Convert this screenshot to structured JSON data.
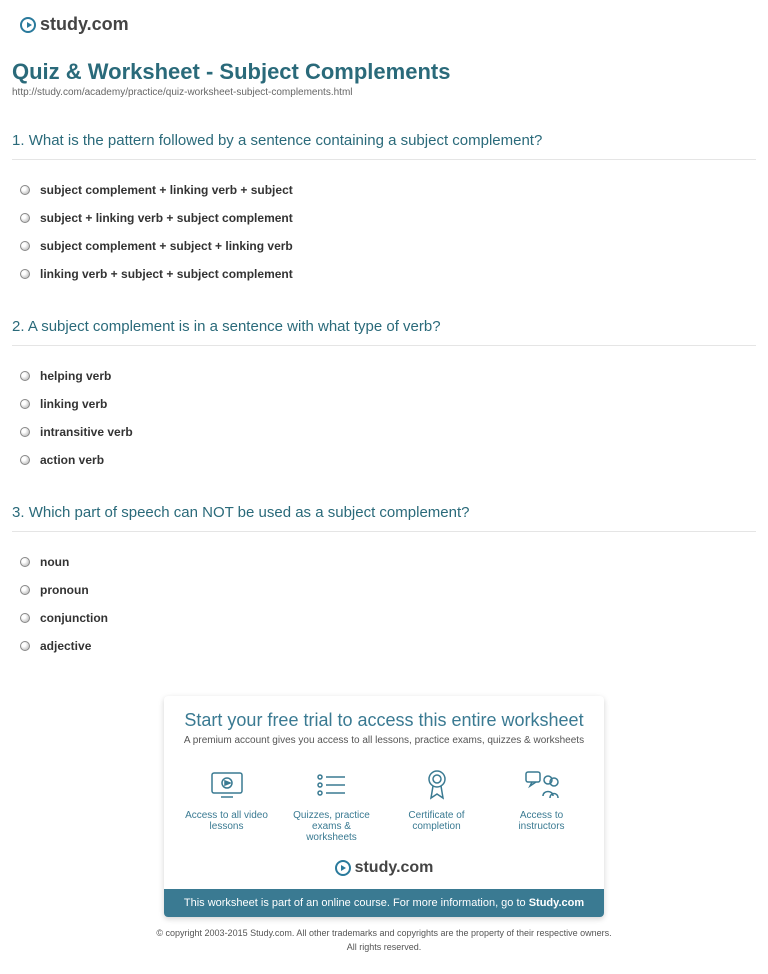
{
  "brand": {
    "name": "study.com"
  },
  "header": {
    "title": "Quiz & Worksheet - Subject Complements",
    "url": "http://study.com/academy/practice/quiz-worksheet-subject-complements.html"
  },
  "questions": [
    {
      "number": "1.",
      "prompt": "What is the pattern followed by a sentence containing a subject complement?",
      "options": [
        "subject complement + linking verb + subject",
        "subject + linking verb + subject complement",
        "subject complement + subject + linking verb",
        "linking verb + subject + subject complement"
      ]
    },
    {
      "number": "2.",
      "prompt": "A subject complement is in a sentence with what type of verb?",
      "options": [
        "helping verb",
        "linking verb",
        "intransitive verb",
        "action verb"
      ]
    },
    {
      "number": "3.",
      "prompt": "Which part of speech can NOT be used as a subject complement?",
      "options": [
        "noun",
        "pronoun",
        "conjunction",
        "adjective"
      ]
    }
  ],
  "promo": {
    "title": "Start your free trial to access this entire worksheet",
    "subtitle": "A premium account gives you access to all lessons, practice exams, quizzes & worksheets",
    "features": [
      "Access to all video lessons",
      "Quizzes, practice exams & worksheets",
      "Certificate of completion",
      "Access to instructors"
    ],
    "banner_prefix": "This worksheet is part of an online course. For more information, go to ",
    "banner_link": "Study.com"
  },
  "copyright": {
    "line1": "© copyright 2003-2015 Study.com. All other trademarks and copyrights are the property of their respective owners.",
    "line2": "All rights reserved."
  }
}
